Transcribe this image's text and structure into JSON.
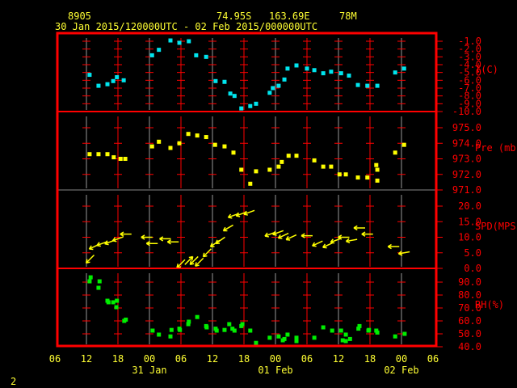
{
  "header": {
    "station": "8905",
    "lat": "74.95S",
    "lon": "163.69E",
    "elev": "78M",
    "period": "30 Jan 2015/120000UTC - 02 Feb 2015/000000UTC"
  },
  "footer_number": "2",
  "colors": {
    "axis": "#ff0000",
    "text": "#ffff33",
    "temp": "#00e5ee",
    "pres": "#ffff00",
    "wind": "#ffff00",
    "rh": "#00ee00"
  },
  "chart_data": {
    "type": "scatter",
    "x_units": "hours since 30 Jan 2015 06UTC",
    "x_range": [
      0,
      72
    ],
    "x_ticks": [
      {
        "h": 0,
        "label": "06"
      },
      {
        "h": 6,
        "label": "12"
      },
      {
        "h": 12,
        "label": "18"
      },
      {
        "h": 18,
        "label": "00"
      },
      {
        "h": 24,
        "label": "06"
      },
      {
        "h": 30,
        "label": "12"
      },
      {
        "h": 36,
        "label": "18"
      },
      {
        "h": 42,
        "label": "00"
      },
      {
        "h": 48,
        "label": "06"
      },
      {
        "h": 54,
        "label": "12"
      },
      {
        "h": 60,
        "label": "18"
      },
      {
        "h": 66,
        "label": "00"
      },
      {
        "h": 72,
        "label": "06"
      }
    ],
    "date_labels": [
      {
        "h": 18,
        "label": "31 Jan"
      },
      {
        "h": 42,
        "label": "01 Feb"
      },
      {
        "h": 66,
        "label": "02 Feb"
      }
    ],
    "panels": [
      {
        "name": "T(C)",
        "key": "temp",
        "ylim": [
          -10,
          -0.2
        ],
        "ticks": [
          -1,
          -2,
          -3,
          -4,
          -5,
          -6,
          -7,
          -8,
          -9,
          -10
        ],
        "tick_labels": [
          "-1.0",
          "-2.0",
          "-3.0",
          "-4.0",
          "-5.0",
          "-6.0",
          "-7.0",
          "-8.0",
          "-9.0",
          "-10.0"
        ],
        "points": [
          [
            6.6,
            -5.3
          ],
          [
            8.3,
            -6.7
          ],
          [
            10.0,
            -6.5
          ],
          [
            11.1,
            -6.1
          ],
          [
            11.8,
            -5.6
          ],
          [
            13.1,
            -6.0
          ],
          [
            18.5,
            -2.8
          ],
          [
            19.8,
            -2.1
          ],
          [
            22.0,
            -0.9
          ],
          [
            23.7,
            -1.2
          ],
          [
            25.5,
            -1.0
          ],
          [
            26.9,
            -2.8
          ],
          [
            28.8,
            -3.0
          ],
          [
            30.6,
            -6.1
          ],
          [
            32.3,
            -6.2
          ],
          [
            33.4,
            -7.7
          ],
          [
            34.2,
            -8.0
          ],
          [
            35.5,
            -9.6
          ],
          [
            37.2,
            -9.3
          ],
          [
            38.3,
            -9.0
          ],
          [
            40.9,
            -7.6
          ],
          [
            41.5,
            -7.0
          ],
          [
            42.6,
            -6.7
          ],
          [
            43.7,
            -5.9
          ],
          [
            44.3,
            -4.5
          ],
          [
            46.0,
            -4.1
          ],
          [
            48.0,
            -4.5
          ],
          [
            49.4,
            -4.7
          ],
          [
            51.1,
            -5.1
          ],
          [
            52.6,
            -4.9
          ],
          [
            54.5,
            -5.1
          ],
          [
            56.0,
            -5.4
          ],
          [
            57.7,
            -6.6
          ],
          [
            59.5,
            -6.7
          ],
          [
            61.4,
            -6.7
          ],
          [
            64.8,
            -5.0
          ],
          [
            66.5,
            -4.5
          ]
        ]
      },
      {
        "name": "Pre (mb)",
        "key": "pres",
        "ylim": [
          971,
          976
        ],
        "ticks": [
          975,
          974,
          973,
          972,
          971
        ],
        "tick_labels": [
          "975.0",
          "974.0",
          "973.0",
          "972.0",
          "971.0"
        ],
        "points": [
          [
            6.6,
            973.3
          ],
          [
            8.3,
            973.3
          ],
          [
            10.0,
            973.3
          ],
          [
            11.2,
            973.1
          ],
          [
            12.5,
            973.0
          ],
          [
            13.4,
            973.0
          ],
          [
            18.5,
            973.8
          ],
          [
            19.8,
            974.1
          ],
          [
            22.0,
            973.7
          ],
          [
            23.7,
            974.0
          ],
          [
            25.4,
            974.6
          ],
          [
            27.1,
            974.5
          ],
          [
            28.8,
            974.4
          ],
          [
            30.5,
            973.9
          ],
          [
            32.3,
            973.8
          ],
          [
            34.0,
            973.4
          ],
          [
            35.5,
            972.3
          ],
          [
            37.2,
            971.4
          ],
          [
            38.3,
            972.2
          ],
          [
            40.9,
            972.3
          ],
          [
            42.6,
            972.5
          ],
          [
            43.2,
            972.8
          ],
          [
            44.5,
            973.2
          ],
          [
            46.0,
            973.2
          ],
          [
            49.4,
            972.9
          ],
          [
            51.1,
            972.5
          ],
          [
            52.6,
            972.5
          ],
          [
            54.2,
            972.0
          ],
          [
            55.4,
            972.0
          ],
          [
            57.7,
            971.8
          ],
          [
            59.5,
            971.8
          ],
          [
            61.4,
            971.6
          ],
          [
            61.4,
            972.3
          ],
          [
            61.2,
            972.6
          ],
          [
            64.8,
            973.4
          ],
          [
            66.5,
            973.9
          ]
        ]
      },
      {
        "name": "SPD(MPS)",
        "key": "wind",
        "ylim": [
          0,
          25
        ],
        "ticks": [
          20,
          15,
          10,
          5,
          0
        ],
        "tick_labels": [
          "20.0",
          "15.0",
          "10.0",
          "5.0",
          "0.0"
        ],
        "points": [
          [
            6.7,
            3,
            225
          ],
          [
            7.5,
            7,
            205
          ],
          [
            9,
            8,
            200
          ],
          [
            10.5,
            8.5,
            200
          ],
          [
            12,
            9.5,
            200
          ],
          [
            13.5,
            11,
            180
          ],
          [
            17.5,
            10,
            180
          ],
          [
            18.5,
            8,
            180
          ],
          [
            21,
            9.5,
            180
          ],
          [
            22.5,
            8.5,
            180
          ],
          [
            24,
            1.5,
            225
          ],
          [
            25.5,
            2.5,
            45
          ],
          [
            26.5,
            2.5,
            225
          ],
          [
            27.5,
            2,
            225
          ],
          [
            29,
            5,
            225
          ],
          [
            30.5,
            8,
            215
          ],
          [
            31.5,
            9,
            215
          ],
          [
            33,
            13,
            210
          ],
          [
            34,
            17,
            200
          ],
          [
            35.5,
            17.5,
            200
          ],
          [
            37,
            18,
            200
          ],
          [
            41,
            11,
            200
          ],
          [
            42.5,
            11.5,
            200
          ],
          [
            43.5,
            10.5,
            205
          ],
          [
            45,
            10,
            205
          ],
          [
            48,
            10.5,
            180
          ],
          [
            50,
            8,
            205
          ],
          [
            52,
            7.5,
            205
          ],
          [
            53.5,
            9,
            200
          ],
          [
            55,
            10,
            180
          ],
          [
            56.5,
            9,
            190
          ],
          [
            58,
            13,
            180
          ],
          [
            59.5,
            11,
            180
          ],
          [
            64.5,
            7,
            180
          ],
          [
            66.5,
            5,
            190
          ]
        ]
      },
      {
        "name": "RH(%)",
        "key": "rh",
        "ylim": [
          40,
          100
        ],
        "ticks": [
          90,
          80,
          70,
          60,
          50,
          40
        ],
        "tick_labels": [
          "90.0",
          "80.0",
          "70.0",
          "60.0",
          "50.0",
          "40.0"
        ],
        "points": [
          [
            6.6,
            90.6
          ],
          [
            6.8,
            93.7
          ],
          [
            8.5,
            90.6
          ],
          [
            8.3,
            85.6
          ],
          [
            10,
            75.6
          ],
          [
            10.2,
            74.4
          ],
          [
            11.1,
            74.4
          ],
          [
            11.8,
            75.6
          ],
          [
            11.7,
            70.6
          ],
          [
            13.2,
            60
          ],
          [
            13.5,
            61
          ],
          [
            18.6,
            52.5
          ],
          [
            19.8,
            49.4
          ],
          [
            22.2,
            53
          ],
          [
            22,
            48
          ],
          [
            23.7,
            54
          ],
          [
            23.8,
            53
          ],
          [
            25.4,
            57.5
          ],
          [
            25.5,
            59.4
          ],
          [
            27.1,
            63
          ],
          [
            28.8,
            56
          ],
          [
            28.9,
            55
          ],
          [
            30.6,
            54
          ],
          [
            30.8,
            52.5
          ],
          [
            32.3,
            53
          ],
          [
            33.2,
            57.5
          ],
          [
            33.8,
            54
          ],
          [
            34.2,
            52.5
          ],
          [
            35.5,
            56
          ],
          [
            35.7,
            57.5
          ],
          [
            37.2,
            52.5
          ],
          [
            38.3,
            43
          ],
          [
            40.9,
            47
          ],
          [
            42.6,
            48
          ],
          [
            43.7,
            46
          ],
          [
            43.4,
            45
          ],
          [
            44.3,
            49.4
          ],
          [
            46,
            47
          ],
          [
            46,
            44.4
          ],
          [
            49.4,
            47
          ],
          [
            51.1,
            55
          ],
          [
            52.8,
            52.5
          ],
          [
            54.5,
            52.5
          ],
          [
            54.8,
            45
          ],
          [
            55.4,
            44.4
          ],
          [
            55.4,
            49.4
          ],
          [
            56.2,
            46
          ],
          [
            57.8,
            54
          ],
          [
            58,
            56
          ],
          [
            59.7,
            52.5
          ],
          [
            59.8,
            53
          ],
          [
            61.2,
            52.5
          ],
          [
            61.4,
            51
          ],
          [
            64.8,
            48
          ],
          [
            66.6,
            50
          ]
        ]
      }
    ]
  }
}
